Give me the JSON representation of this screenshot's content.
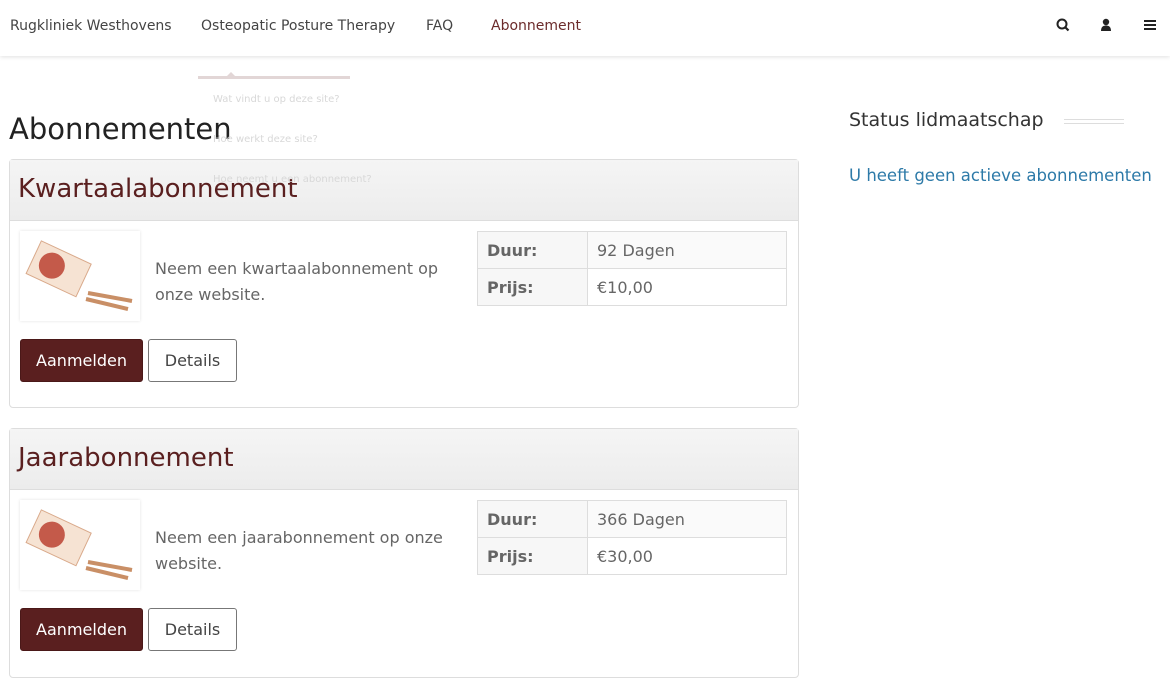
{
  "nav": {
    "brand": "Rugkliniek Westhovens",
    "items": [
      "Osteopatic Posture Therapy",
      "FAQ",
      "Abonnement"
    ],
    "active": "Abonnement"
  },
  "dropdown": {
    "items": [
      "Wat vindt u op deze site?",
      "Hoe werkt deze site?",
      "Hoe neemt u een abonnement?"
    ]
  },
  "page_title": "Abonnementen",
  "subscriptions": [
    {
      "title": "Kwartaalabonnement",
      "description": "Neem een kwartaalabonnement op onze website.",
      "duration_label": "Duur:",
      "duration": "92 Dagen",
      "price_label": "Prijs:",
      "price": "€10,00",
      "signup": "Aanmelden",
      "details": "Details"
    },
    {
      "title": "Jaarabonnement",
      "description": "Neem een jaarabonnement op onze website.",
      "duration_label": "Duur:",
      "duration": "366 Dagen",
      "price_label": "Prijs:",
      "price": "€30,00",
      "signup": "Aanmelden",
      "details": "Details"
    }
  ],
  "sidebar": {
    "title": "Status lidmaatschap",
    "status_link": "U heeft geen actieve abonnementen"
  },
  "colors": {
    "brand": "#5a1f1f",
    "link": "#2d7aa8"
  }
}
